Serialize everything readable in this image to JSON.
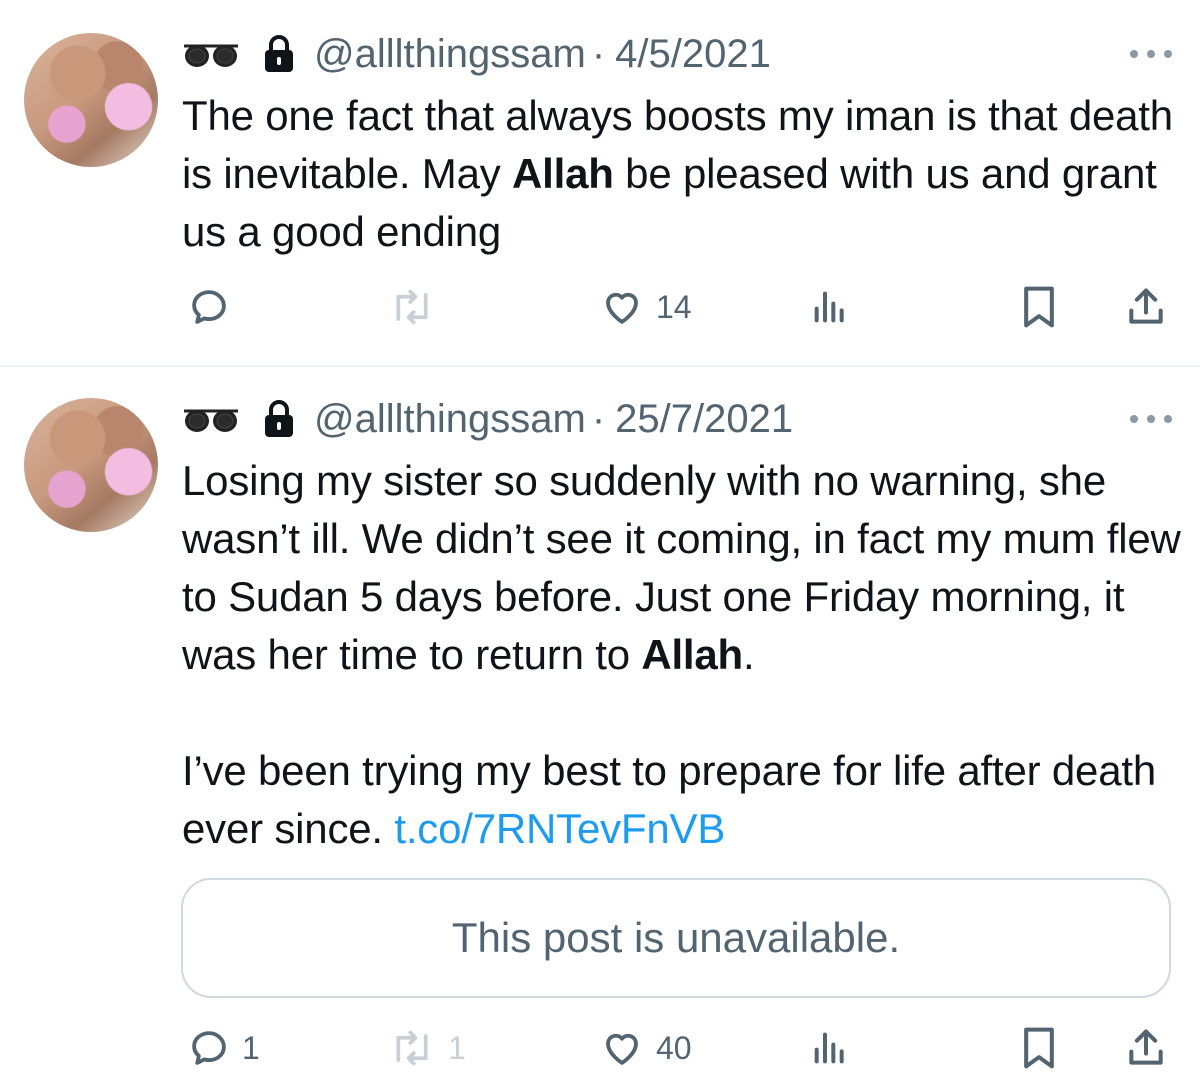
{
  "tweets": [
    {
      "emoji": "🕶",
      "handle": "@alllthingssam",
      "separator": "·",
      "date": "4/5/2021",
      "text_before": "The one fact that always boosts my iman is that death is inevitable. May ",
      "text_bold": "Allah",
      "text_after": " be pleased with us and grant us a good ending",
      "actions": {
        "reply_count": "",
        "repost_count": "",
        "like_count": "14"
      },
      "icons": [
        "reply-icon",
        "repost-icon",
        "like-icon",
        "views-icon",
        "bookmark-icon",
        "share-icon"
      ]
    },
    {
      "emoji": "🕶",
      "handle": "@alllthingssam",
      "separator": "·",
      "date": "25/7/2021",
      "text_before": "Losing my sister so suddenly with no warning, she wasn’t ill. We didn’t see it coming, in fact my mum flew to Sudan 5 days before. Just one Friday morning, it was her time to return to ",
      "text_bold": "Allah",
      "text_after": ".\n\nI’ve been trying my best to prepare for life after death ever since. ",
      "link": "t.co/7RNTevFnVB",
      "quoted_post": "This post is unavailable.",
      "actions": {
        "reply_count": "1",
        "repost_count": "1",
        "like_count": "40"
      },
      "icons": [
        "reply-icon",
        "repost-icon",
        "like-icon",
        "views-icon",
        "bookmark-icon",
        "share-icon"
      ]
    }
  ],
  "colors": {
    "text": "#0f1419",
    "secondary": "#536471",
    "link": "#1d9bf0",
    "disabled": "#c8d0d6",
    "border": "#cfd9de"
  }
}
